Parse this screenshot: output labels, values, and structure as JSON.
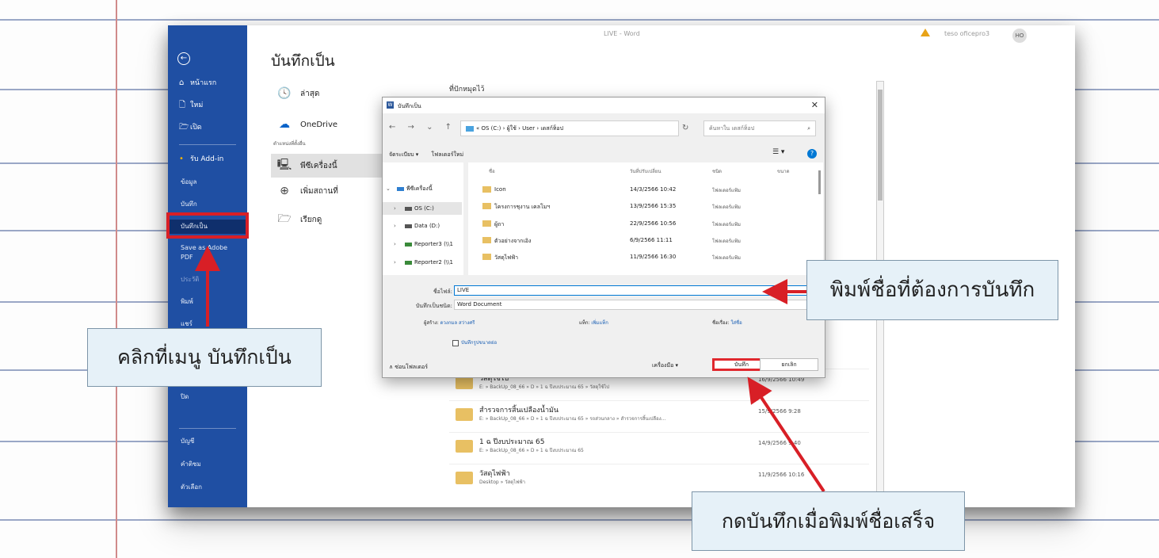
{
  "window": {
    "title": "LIVE - Word",
    "user": "teso oficepro3",
    "avatar": "HO"
  },
  "backstage": {
    "items": [
      {
        "label": "หน้าแรก",
        "icon": "⌂"
      },
      {
        "label": "ใหม่",
        "icon": "🗋"
      },
      {
        "label": "เปิด",
        "icon": "🗁"
      },
      {
        "label": "รับ Add-in",
        "icon": "•"
      },
      {
        "label": "ข้อมูล"
      },
      {
        "label": "บันทึก"
      },
      {
        "label": "บันทึกเป็น"
      },
      {
        "label": "Save as Adobe PDF"
      },
      {
        "label": "ประวัติ"
      },
      {
        "label": "พิมพ์"
      },
      {
        "label": "แชร์"
      },
      {
        "label": "ปิด"
      },
      {
        "label": "บัญชี"
      },
      {
        "label": "คำติชม"
      },
      {
        "label": "ตัวเลือก"
      }
    ]
  },
  "saveas": {
    "title": "บันทึกเป็น",
    "locations": [
      {
        "label": "ล่าสุด",
        "icon": "🕓"
      },
      {
        "label": "OneDrive",
        "icon": "☁"
      },
      {
        "label": "พีซีเครื่องนี้",
        "icon": "🖳"
      },
      {
        "label": "เพิ่มสถานที่",
        "icon": "⊕"
      },
      {
        "label": "เรียกดู",
        "icon": "🗁"
      }
    ],
    "location_group_label": "ตำแหน่งที่ตั้งอื่น",
    "pinned_header": "ที่ปักหมุดไว้",
    "recent": [
      {
        "name": "วัสดุใช้ไป",
        "path": "E: » BackUp_08_66 » D » 1 ฉ ปีงบประมาณ 65 » วัสดุใช้ไป",
        "date": "16/9/2566 10:49"
      },
      {
        "name": "สำรวจการสิ้นเปลืองน้ำมัน",
        "path": "E: » BackUp_08_66 » D » 1 ฉ ปีงบประมาณ 65 » รถส่วนกลาง » สำรวจการสิ้นเปลือง...",
        "date": "15/9/2566 9:28"
      },
      {
        "name": "1 ฉ ปีงบประมาณ 65",
        "path": "E: » BackUp_08_66 » D » 1 ฉ ปีงบประมาณ 65",
        "date": "14/9/2566 9:40"
      },
      {
        "name": "วัสดุไฟฟ้า",
        "path": "Desktop » วัสดุไฟฟ้า",
        "date": "11/9/2566 10:16"
      }
    ]
  },
  "dialog": {
    "title": "บันทึกเป็น",
    "close": "✕",
    "nav": "← → ⌄ ↑",
    "address": "« OS (C:) › ผู้ใช้ › User › เดสก์ท็อป",
    "refresh": "↻",
    "search_placeholder": "ค้นหาใน เดสก์ท็อป",
    "search_icon": "⌕",
    "toolbar": {
      "organize": "จัดระเบียบ ▾",
      "new_folder": "โฟลเดอร์ใหม่"
    },
    "view_icon": "☰ ▾",
    "help": "?",
    "tree": [
      {
        "chev": "⌄",
        "label": "พีซีเครื่องนี้"
      },
      {
        "chev": "›",
        "label": "OS (C:)"
      },
      {
        "chev": "›",
        "label": "Data (D:)"
      },
      {
        "chev": "›",
        "label": "Reporter3 (\\\\1"
      },
      {
        "chev": "›",
        "label": "Reporter2 (\\\\1"
      }
    ],
    "columns": {
      "name": "ชื่อ",
      "date": "วันที่ปรับเปลี่ยน",
      "type": "ชนิด",
      "size": "ขนาด"
    },
    "files": [
      {
        "name": "Icon",
        "date": "14/3/2566 10:42",
        "type": "โฟลเดอร์แฟ้ม"
      },
      {
        "name": "โครงการชุงาน เคลโมฯ",
        "date": "13/9/2566 15:35",
        "type": "โฟลเดอร์แฟ้ม"
      },
      {
        "name": "ผู้ถา",
        "date": "22/9/2566 10:56",
        "type": "โฟลเดอร์แฟ้ม"
      },
      {
        "name": "ตัวอย่างจากเอิง",
        "date": "6/9/2566 11:11",
        "type": "โฟลเดอร์แฟ้ม"
      },
      {
        "name": "วัสดุไฟฟ้า",
        "date": "11/9/2566 16:30",
        "type": "โฟลเดอร์แฟ้ม"
      }
    ],
    "filename_label": "ชื่อไฟล์:",
    "filename_value": "LIVE",
    "filetype_label": "บันทึกเป็นชนิด:",
    "filetype_value": "Word Document",
    "author_label": "ผู้สร้าง:",
    "author_value": "ดวงกมล สว่างศรี",
    "tags_label": "แท็ก:",
    "tags_value": "เพิ่มแท็ก",
    "subject_label": "ชื่อเรื่อง:",
    "subject_value": "ใส่ชื่อ",
    "thumbnail": "บันทึกรูปขนาดย่อ",
    "hide_folders": "∧ ซ่อนโฟลเดอร์",
    "tools": "เครื่องมือ ▾",
    "save": "บันทึก",
    "cancel": "ยกเลิก"
  },
  "annotations": {
    "type_name": "พิมพ์ชื่อที่ต้องการบันทึก",
    "click_menu": "คลิกที่เมนู บันทึกเป็น",
    "click_save": "กดบันทึกเมื่อพิมพ์ชื่อเสร็จ"
  },
  "colors": {
    "backstage": "#1f4fa3",
    "highlight": "#d81f26",
    "callout_bg": "#e6f1f8"
  }
}
